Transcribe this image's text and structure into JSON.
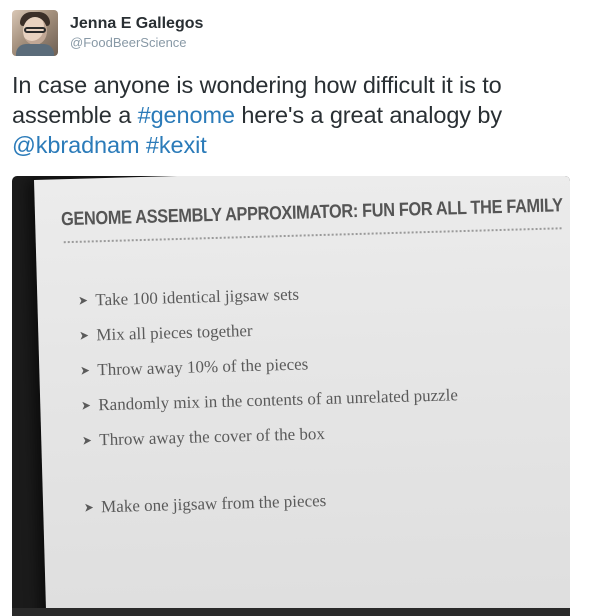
{
  "author": {
    "display_name": "Jenna E Gallegos",
    "handle": "@FoodBeerScience"
  },
  "tweet": {
    "text_part1": "In case anyone is wondering how difficult it is to assemble a ",
    "hashtag_genome": "#genome",
    "text_part2": " here's a great analogy by ",
    "mention": "@kbradnam",
    "text_space": " ",
    "hashtag_kexit": "#kexit"
  },
  "slide": {
    "title": "GENOME ASSEMBLY APPROXIMATOR: FUN FOR ALL THE FAMILY",
    "bullets": [
      "Take 100 identical jigsaw sets",
      "Mix all pieces together",
      "Throw away 10% of the pieces",
      "Randomly mix in the contents of an unrelated puzzle",
      "Throw away the cover of the box"
    ],
    "final_bullet": "Make one jigsaw from the pieces"
  },
  "colors": {
    "link": "#2b7bb9",
    "text": "#292f33",
    "handle": "#8899a6"
  },
  "icons": {
    "bullet": "arrowhead-icon"
  }
}
